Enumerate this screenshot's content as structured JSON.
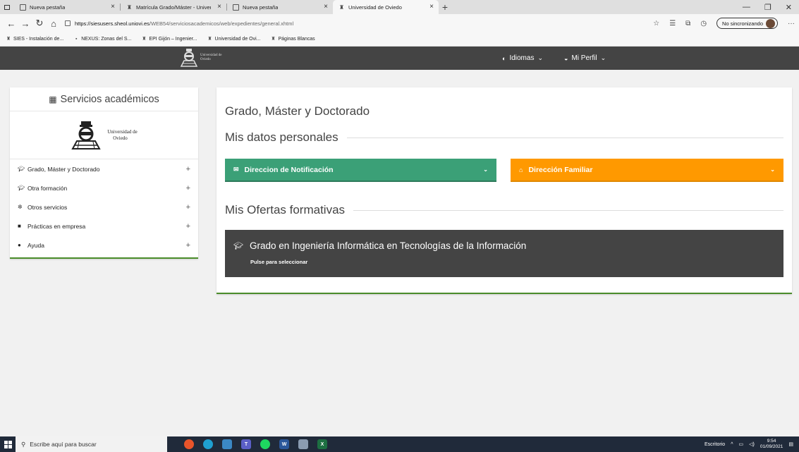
{
  "browser": {
    "tabs": [
      {
        "label": "Nueva pestaña",
        "favicon": "page-icon"
      },
      {
        "label": "Matrícula Grado/Máster - Univer",
        "favicon": "university-seal-icon"
      },
      {
        "label": "Nueva pestaña",
        "favicon": "page-icon"
      },
      {
        "label": "Universidad de Oviedo",
        "favicon": "university-seal-icon",
        "active": true
      }
    ],
    "url_host": "https://siesusers.sheol.uniovi.es",
    "url_path": "/WEB54/serviciosacademicos/web/expedientes/general.xhtml",
    "sync_label": "No sincronizando",
    "bookmarks": [
      "SIES - Instalación de...",
      "NEXUS: Zonas del S...",
      "EPI Gijón – Ingenier...",
      "Universidad de Ovi...",
      "Páginas Blancas"
    ]
  },
  "site": {
    "logo_text_line1": "Universidad de",
    "logo_text_line2": "Oviedo",
    "menu_languages": "Idiomas",
    "menu_profile": "Mi Perfil"
  },
  "sidebar": {
    "title": "Servicios académicos",
    "logo_line1": "Universidad de",
    "logo_line2": "Oviedo",
    "items": [
      {
        "label": "Grado, Máster y Doctorado",
        "icon": "graduation-cap-icon"
      },
      {
        "label": "Otra formación",
        "icon": "graduation-cap-icon"
      },
      {
        "label": "Otros servicios",
        "icon": "gear-icon"
      },
      {
        "label": "Prácticas en empresa",
        "icon": "briefcase-icon"
      },
      {
        "label": "Ayuda",
        "icon": "help-icon"
      }
    ],
    "expand_symbol": "+"
  },
  "main": {
    "page_title": "Grado, Máster y Doctorado",
    "personal_section": "Mis datos personales",
    "panel_notification": "Direccion de Notificación",
    "panel_family": "Dirección Familiar",
    "offers_section": "Mis Ofertas formativas",
    "offer_title": "Grado en Ingeniería Informática en Tecnologías de la Información",
    "offer_hint": "Pulse para seleccionar"
  },
  "taskbar": {
    "search_placeholder": "Escribe aquí para buscar",
    "desktop_label": "Escritorio",
    "time": "9:54",
    "date": "01/09/2021"
  },
  "colors": {
    "header_bg": "#444444",
    "green_panel": "#3ba077",
    "orange_panel": "#ff9900",
    "accent_border": "#4a8c2a"
  }
}
